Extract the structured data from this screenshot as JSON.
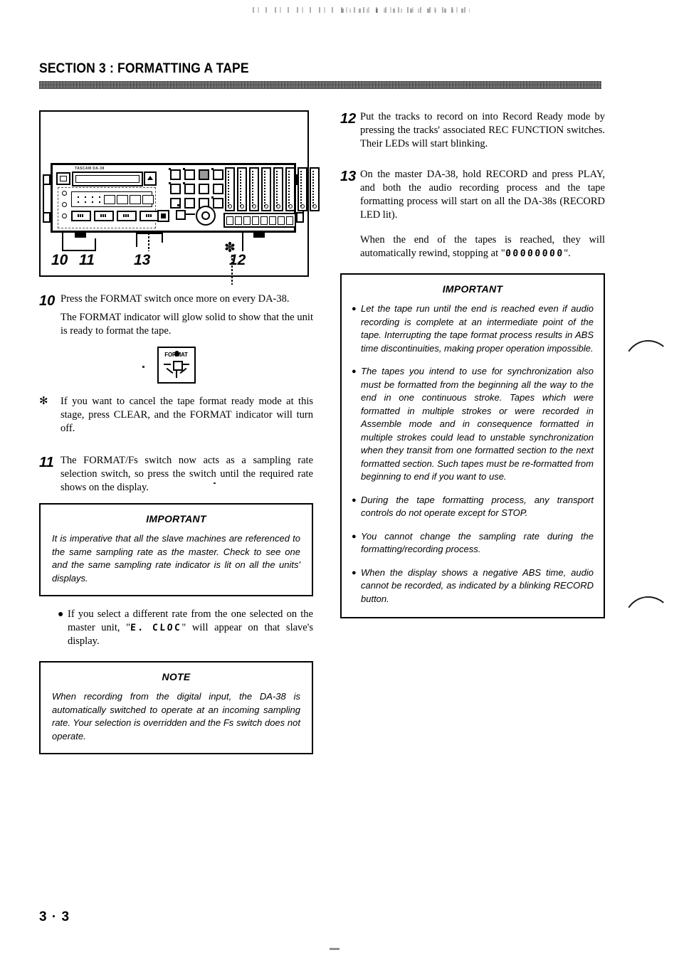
{
  "document": {
    "section_header": "SECTION 3 :  FORMATTING A TAPE",
    "page_number": "3 · 3"
  },
  "figure": {
    "asterisk_marker": "✽",
    "device_brand": "TASCAM DA-38",
    "callouts": [
      {
        "number": "10"
      },
      {
        "number": "11"
      },
      {
        "number": "13"
      },
      {
        "number": "12"
      }
    ]
  },
  "left_column": {
    "step_10": {
      "number": "10",
      "text": "Press the FORMAT switch once more on every DA-38."
    },
    "para_10b": "The FORMAT indicator will glow solid to show that the unit is ready to format the tape.",
    "format_icon": {
      "label": "FORMAT"
    },
    "star_note": {
      "marker": "✻",
      "text": "If you want to cancel the tape format ready mode at this stage, press CLEAR, and the FORMAT indicator will turn off."
    },
    "step_11": {
      "number": "11",
      "text": "The FORMAT/Fs switch now acts as a sampling rate selection switch, so press the switch until the required rate shows on the display."
    },
    "important_box": {
      "title": "IMPORTANT",
      "text": "It is imperative that all the slave machines are referenced to the same sampling rate as the master. Check to see one and the same sampling rate indicator is lit on all the units' displays."
    },
    "bullet_clock": {
      "dot": "●",
      "text_before": "If you select a different rate from the one selected on the master unit, \"",
      "display_code": "E. CLOC",
      "text_after": "\" will appear on that slave's display."
    },
    "note_box": {
      "title": "NOTE",
      "text": "When recording from the digital input, the DA-38 is automatically switched to operate at an incoming sampling rate. Your selection is overridden and the Fs switch does not operate."
    }
  },
  "right_column": {
    "step_12": {
      "number": "12",
      "text": "Put the tracks to record on into Record Ready mode by pressing the tracks' associated REC FUNCTION switches. Their LEDs will start blinking."
    },
    "step_13": {
      "number": "13",
      "text": "On the master DA-38, hold RECORD and press PLAY, and both the audio recording process and the tape formatting process will start on all the DA-38s (RECORD LED lit)."
    },
    "para_13b": {
      "text_before": "When the end of the tapes is reached, they will automatically rewind, stopping at \"",
      "display_code": "00000000",
      "text_after": "\"."
    },
    "important_box": {
      "title": "IMPORTANT",
      "bullets": [
        {
          "dot": "●",
          "text": "Let the tape run until the end is reached even if audio recording is complete at an intermediate point of the tape. Interrupting the tape format process results in ABS time discontinuities, making proper operation impossible."
        },
        {
          "dot": "●",
          "text": "The tapes you intend to use for synchronization also must be formatted from the beginning all the way to the end in one continuous stroke. Tapes which were formatted in multiple strokes or were recorded in Assemble mode and in consequence formatted in multiple strokes could lead to unstable synchronization when they transit from one formatted section to the next formatted section. Such tapes must be re-formatted from beginning to end if you want to use."
        },
        {
          "dot": "●",
          "text": "During the tape formatting process, any transport controls do not operate except for STOP."
        },
        {
          "dot": "●",
          "text": "You cannot change the sampling rate during the formatting/recording process."
        },
        {
          "dot": "●",
          "text": "When the display shows a negative ABS time, audio cannot be recorded, as indicated by a blinking RECORD button."
        }
      ]
    }
  }
}
